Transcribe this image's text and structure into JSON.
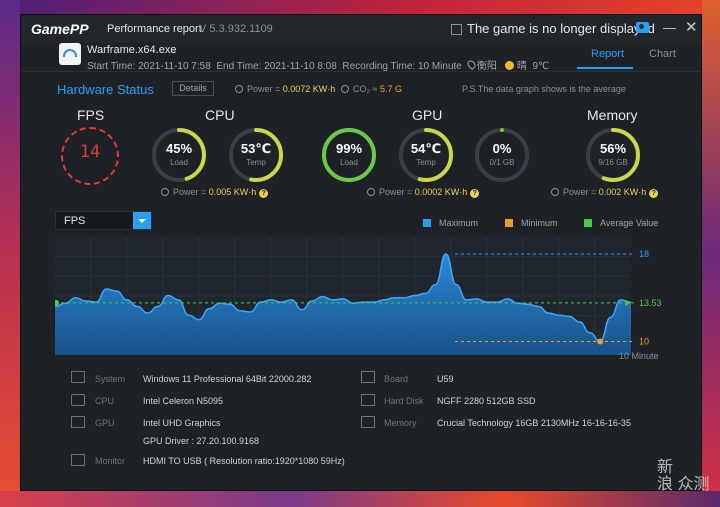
{
  "app": {
    "logo": "GamePP",
    "title": "Performance report",
    "version": "V 5.3.932.1109",
    "not_displayed": "The game is no longer displayed"
  },
  "game": {
    "name": "Warframe.x64.exe",
    "start": "Start Time: 2021-11-10 7:58",
    "end": "End Time: 2021-11-10 8:08",
    "recording": "Recording Time: 10 Minute",
    "location": "衡阳",
    "weather": "晴",
    "temp": "9℃"
  },
  "tabs": {
    "report": "Report",
    "chart": "Chart"
  },
  "status": {
    "title": "Hardware Status",
    "details": "Details",
    "power_label": "Power = ",
    "power_value": "0.0072 KW·h",
    "co2_label": "CO₂ ≈ ",
    "co2_value": "5.7 G",
    "note": "P.S.The data graph shows is the average"
  },
  "fps": {
    "label": "FPS",
    "value": "14"
  },
  "cpu": {
    "label": "CPU",
    "load": {
      "value": "45%",
      "sub": "Load",
      "pct": 45,
      "color": "#c8d84a"
    },
    "temp": {
      "value": "53℃",
      "sub": "Temp",
      "pct": 53,
      "color": "#c8d84a"
    },
    "power_label": "Power = ",
    "power_value": "0.005 KW·h"
  },
  "gpu": {
    "label": "GPU",
    "load": {
      "value": "99%",
      "sub": "Load",
      "pct": 99,
      "color": "#6cc84a"
    },
    "temp": {
      "value": "54℃",
      "sub": "Temp",
      "pct": 54,
      "color": "#c8d84a"
    },
    "mem": {
      "value": "0%",
      "sub": "0/1 GB",
      "pct": 0,
      "color": "#6cc84a"
    },
    "power_label": "Power = ",
    "power_value": "0.0002 KW·h"
  },
  "memory": {
    "label": "Memory",
    "usage": {
      "value": "56%",
      "sub": "9/16 GB",
      "pct": 56,
      "color": "#c8d84a"
    },
    "power_label": "Power = ",
    "power_value": "0.002 KW·h"
  },
  "graph": {
    "select": "FPS",
    "legend_max": "Maximum",
    "legend_min": "Minimum",
    "legend_avg": "Average Value",
    "max_label": "18",
    "avg_label": "13.53",
    "min_label": "10",
    "duration": "10 Minute"
  },
  "chart_data": {
    "type": "area",
    "ylabel": "FPS",
    "max": 18,
    "min": 10,
    "avg": 13.53,
    "ylim": [
      9.5,
      19
    ],
    "values": [
      13.2,
      13.5,
      14.0,
      13.7,
      13.6,
      14.8,
      14.6,
      13.8,
      13.2,
      12.6,
      13.2,
      14.2,
      13.8,
      12.4,
      12.0,
      13.0,
      13.5,
      13.4,
      12.8,
      12.7,
      13.6,
      13.8,
      13.6,
      13.8,
      12.9,
      13.7,
      14.1,
      13.8,
      13.9,
      13.5,
      13.6,
      13.6,
      13.8,
      14.0,
      14.0,
      14.2,
      14.4,
      15.2,
      18.0,
      15.2,
      13.8,
      13.9,
      13.6,
      13.6,
      13.9,
      13.5,
      13.4,
      13.2,
      12.6,
      12.4,
      12.3,
      11.8,
      10.8,
      10.0,
      12.2,
      13.8,
      13.6
    ]
  },
  "system": {
    "system_label": "System",
    "system_value": "Windows 11 Professional 64Bit  22000.282",
    "cpu_label": "CPU",
    "cpu_value": "Intel Celeron N5095",
    "gpu_label": "GPU",
    "gpu_value": "Intel UHD Graphics",
    "gpu_driver": "GPU Driver : 27.20.100.9168",
    "monitor_label": "Monitor",
    "monitor_value": "HDMI TO USB ( Resolution ratio:1920*1080 59Hz)",
    "board_label": "Board",
    "board_value": "U59",
    "disk_label": "Hard Disk",
    "disk_value": "NGFF 2280 512GB SSD",
    "memory_label": "Memory",
    "memory_value": "Crucial Technology 16GB 2130MHz 16-16-16-35"
  },
  "watermark": "新\n浪 众测",
  "colors": {
    "accent": "#2a9df4",
    "max": "#2a9df4",
    "min": "#e8a020",
    "avg": "#4ac84a",
    "fps": "#e23a3a"
  }
}
